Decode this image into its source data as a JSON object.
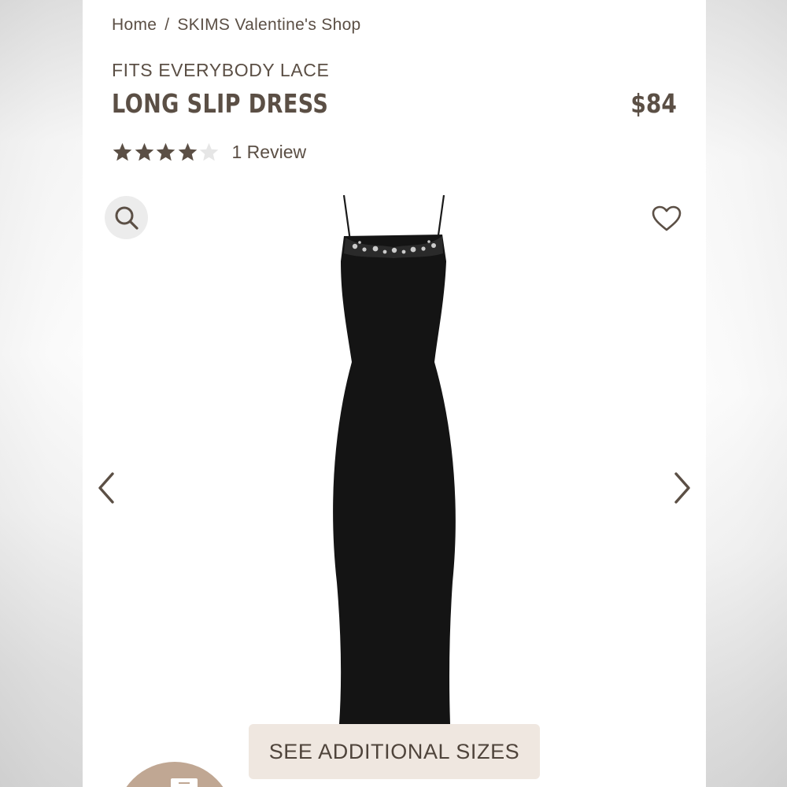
{
  "breadcrumb": {
    "home": "Home",
    "separator": "/",
    "current": "SKIMS Valentine's Shop"
  },
  "product": {
    "collection": "FITS EVERYBODY LACE",
    "name": "LONG SLIP DRESS",
    "price": "$84",
    "rating": 4,
    "rating_max": 5,
    "review_count_label": "1 Review"
  },
  "gallery": {
    "search_icon": "search-icon",
    "favorite_icon": "heart-icon",
    "prev_icon": "chevron-left-icon",
    "next_icon": "chevron-right-icon"
  },
  "actions": {
    "sizes_label": "SEE ADDITIONAL SIZES"
  },
  "colors": {
    "text": "#5b4f45",
    "star_filled": "#5b4f45",
    "star_empty": "#e6e6e6",
    "button_bg": "#efe7e0",
    "chat_bg": "#c0a793",
    "dress": "#141414"
  }
}
